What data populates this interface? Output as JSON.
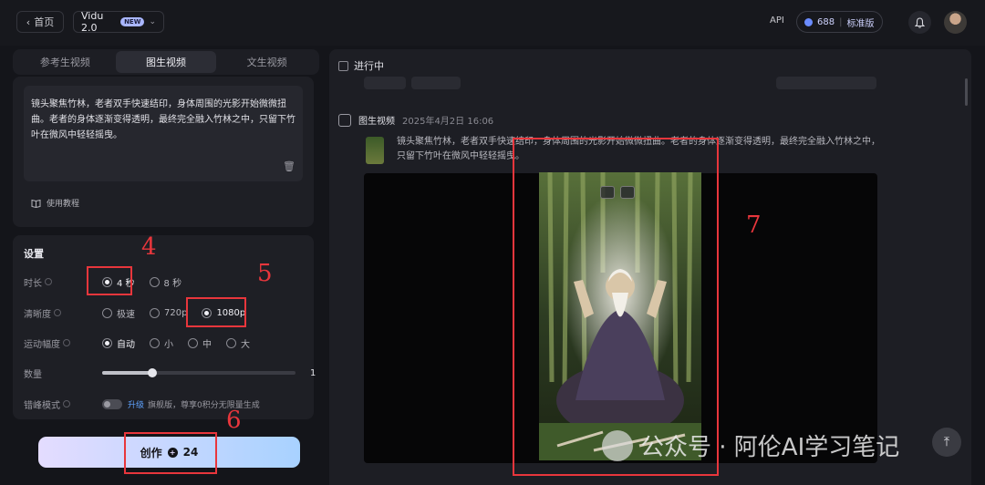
{
  "header": {
    "home_label": "首页",
    "model_label": "Vidu 2.0",
    "new_badge": "NEW",
    "api_label": "API",
    "credits": "688",
    "plan": "标准版"
  },
  "tabs": [
    "参考生视频",
    "图生视频",
    "文生视频"
  ],
  "prompt": {
    "text": "镜头聚焦竹林，老者双手快速结印，身体周围的光影开始微微扭曲。老者的身体逐渐变得透明，最终完全融入竹林之中，只留下竹叶在微风中轻轻摇曳。",
    "tutorial_label": "使用教程"
  },
  "settings": {
    "title": "设置",
    "duration": {
      "label": "时长",
      "options": [
        "4 秒",
        "8 秒"
      ],
      "selected": "4 秒"
    },
    "resolution": {
      "label": "清晰度",
      "options": [
        "极速",
        "720p",
        "1080p"
      ],
      "selected": "1080p"
    },
    "motion": {
      "label": "运动幅度",
      "options": [
        "自动",
        "小",
        "中",
        "大"
      ],
      "selected": "自动"
    },
    "quantity": {
      "label": "数量",
      "value": "1",
      "slider_fraction": 0.26
    },
    "peak_mode": {
      "label": "错峰模式",
      "upgrade_link": "升级",
      "hint": "旗舰版，尊享0积分无限量生成"
    }
  },
  "create_button": {
    "label": "创作",
    "cost": "24"
  },
  "results": {
    "status_label": "进行中",
    "task_type": "图生视频",
    "task_time": "2025年4月2日 16:06",
    "task_prompt": "镜头聚焦竹林，老者双手快速结印，身体周围的光影开始微微扭曲。老者的身体逐渐变得透明，最终完全融入竹林之中，只留下竹叶在微风中轻轻摇曳。"
  },
  "annotations": [
    "4",
    "5",
    "6",
    "7"
  ],
  "watermark": "公众号 · 阿伦AI学习笔记",
  "colors": {
    "accent_blue": "#5fa3ff",
    "annotation_red": "#e8363c",
    "panel_bg": "#1e1f25"
  }
}
